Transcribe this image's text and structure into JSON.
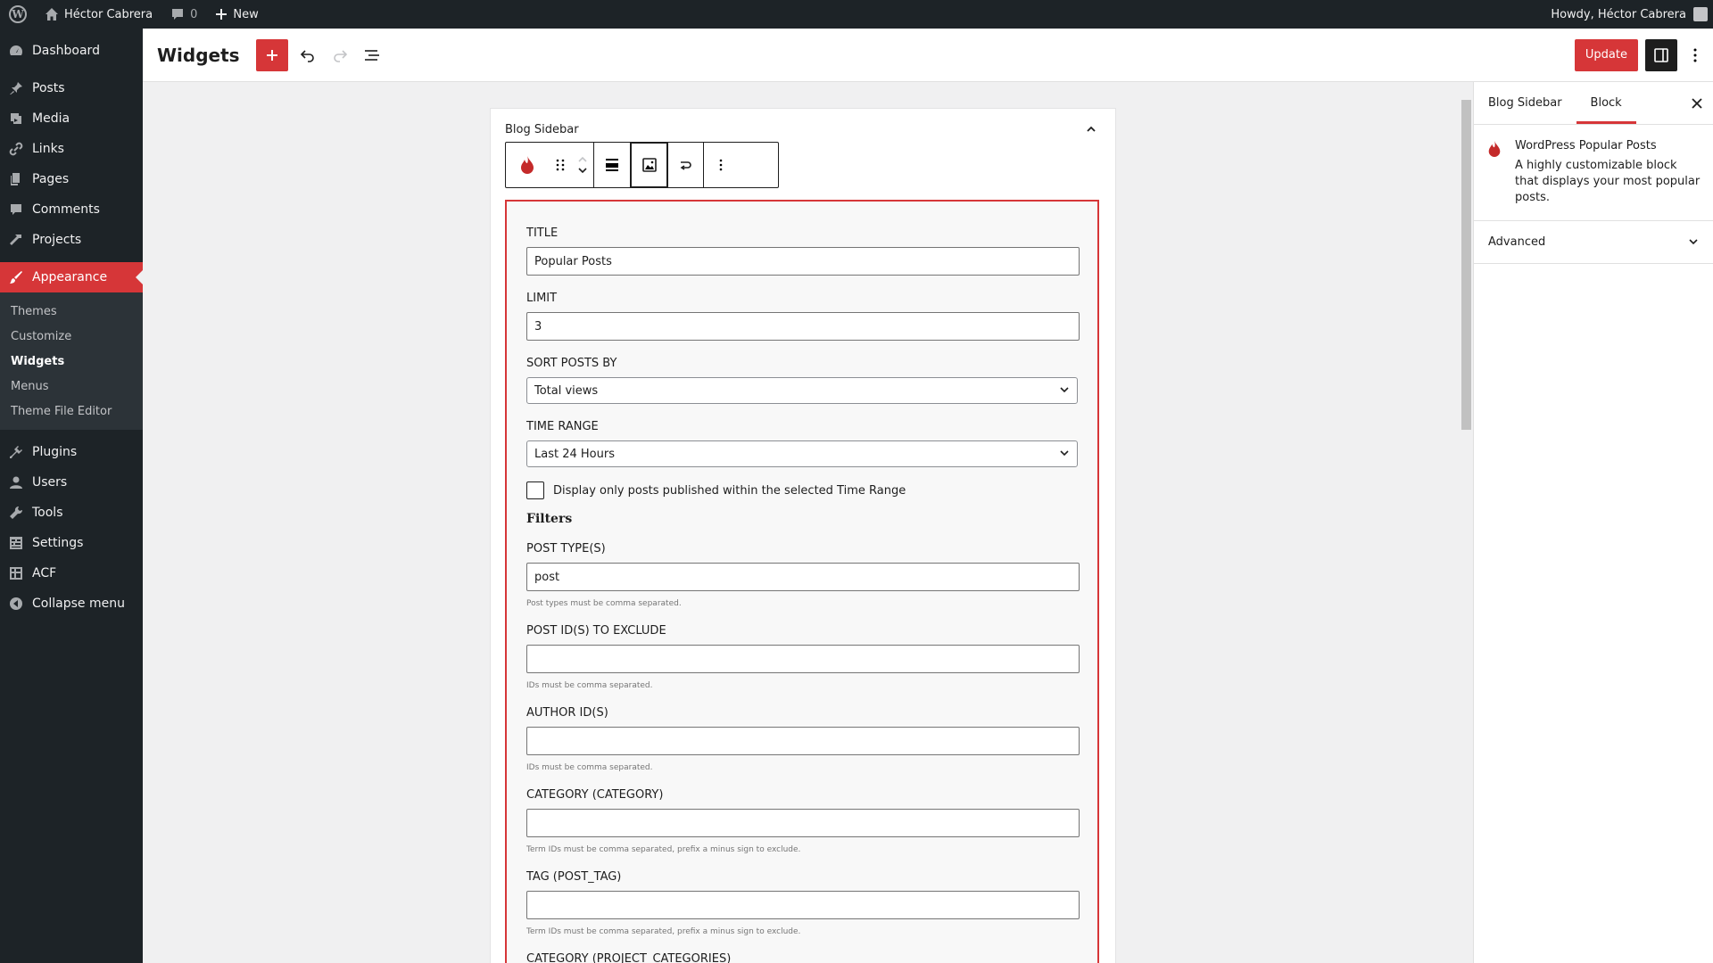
{
  "adminbar": {
    "site_name": "Héctor Cabrera",
    "comments_count": "0",
    "new_label": "New",
    "howdy": "Howdy, Héctor Cabrera"
  },
  "menu": {
    "dashboard": "Dashboard",
    "posts": "Posts",
    "media": "Media",
    "links": "Links",
    "pages": "Pages",
    "comments": "Comments",
    "projects": "Projects",
    "appearance": "Appearance",
    "submenu": [
      "Themes",
      "Customize",
      "Widgets",
      "Menus",
      "Theme File Editor"
    ],
    "plugins": "Plugins",
    "users": "Users",
    "tools": "Tools",
    "settings": "Settings",
    "acf": "ACF",
    "collapse": "Collapse menu"
  },
  "header": {
    "title": "Widgets",
    "update_label": "Update"
  },
  "widget_area": {
    "title": "Blog Sidebar"
  },
  "form": {
    "title_label": "TITLE",
    "title_value": "Popular Posts",
    "limit_label": "LIMIT",
    "limit_value": "3",
    "sort_label": "SORT POSTS BY",
    "sort_value": "Total views",
    "range_label": "TIME RANGE",
    "range_value": "Last 24 Hours",
    "checkbox_label": "Display only posts published within the selected Time Range",
    "filters_heading": "Filters",
    "post_types_label": "POST TYPE(S)",
    "post_types_value": "post",
    "post_types_help": "Post types must be comma separated.",
    "exclude_label": "POST ID(S) TO EXCLUDE",
    "exclude_value": "",
    "exclude_help": "IDs must be comma separated.",
    "author_label": "AUTHOR ID(S)",
    "author_value": "",
    "author_help": "IDs must be comma separated.",
    "category_label": "CATEGORY (CATEGORY)",
    "category_value": "",
    "category_help": "Term IDs must be comma separated, prefix a minus sign to exclude.",
    "tag_label": "TAG (POST_TAG)",
    "tag_value": "",
    "tag_help": "Term IDs must be comma separated, prefix a minus sign to exclude.",
    "project_cat_label": "CATEGORY (PROJECT_CATEGORIES)"
  },
  "sidebar": {
    "tab_area": "Blog Sidebar",
    "tab_block": "Block",
    "block_name": "WordPress Popular Posts",
    "block_desc": "A highly customizable block that displays your most popular posts.",
    "advanced": "Advanced"
  },
  "colors": {
    "accent": "#d63638",
    "admin_dark": "#1d2327"
  }
}
